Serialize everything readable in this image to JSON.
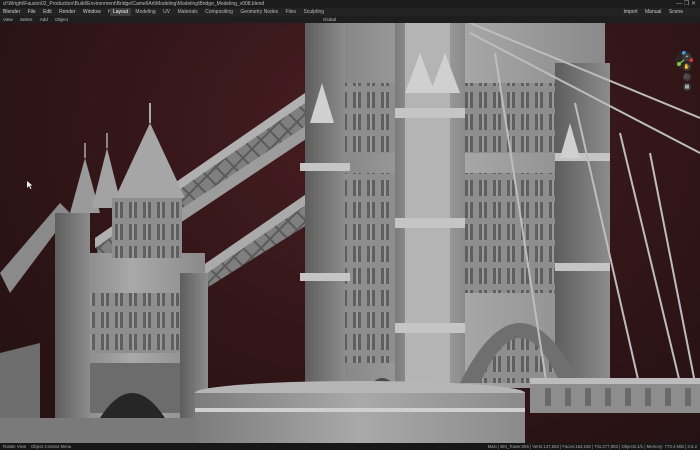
{
  "titlebar": {
    "path": "d:\\Wright\\Fausto\\02_Production\\Build\\Environment\\Bridge\\Camel\\Art\\Modeling\\Modeling\\Bridge_Modeling_v008.blend",
    "controls": "— ❐ ✕"
  },
  "menu": [
    "Blender",
    "File",
    "Edit",
    "Render",
    "Window",
    "Help"
  ],
  "workspace_tabs": [
    {
      "label": "Layout",
      "active": true
    },
    {
      "label": "Modeling",
      "active": false
    },
    {
      "label": "UV",
      "active": false
    },
    {
      "label": "Materials",
      "active": false
    },
    {
      "label": "Compositing",
      "active": false
    },
    {
      "label": "Geometry Nodes",
      "active": false
    },
    {
      "label": "Files",
      "active": false
    },
    {
      "label": "Sculpting",
      "active": false
    }
  ],
  "scene": {
    "import_label": "Import",
    "manual_label": "Manual",
    "scene_label": "Scene"
  },
  "header2": [
    "View",
    "Select",
    "Add",
    "Object",
    "Global"
  ],
  "status": {
    "left": "Rotate View",
    "mid": "Object Context Menu",
    "right": "Main | BM_Tower.006 | Verts:137,553 | Faces:153,248 | Tris:277,903 | Objects:1/1 | Memory: 773.4 MiB | 3.6.2"
  },
  "nav_buttons": [
    "+",
    "✋",
    "🎥",
    "▦"
  ],
  "colors": {
    "background": "#2a1416",
    "stone": "#9b9b9b",
    "accent": "#e23a3a"
  }
}
